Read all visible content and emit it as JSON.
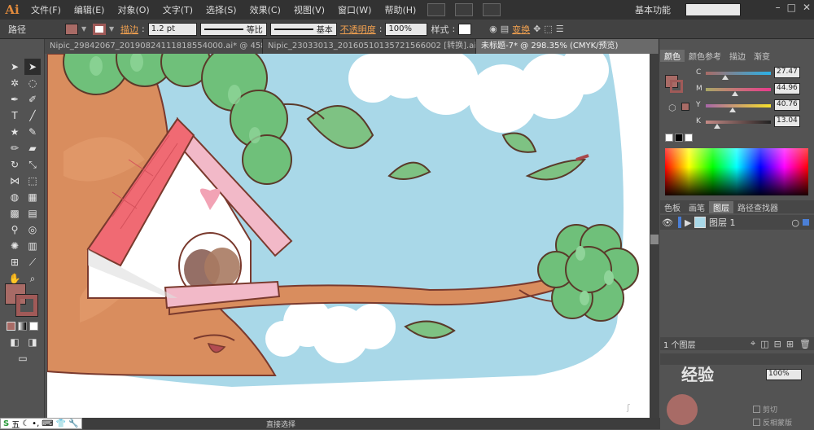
{
  "app": {
    "logo": "Ai"
  },
  "menu": [
    "文件(F)",
    "编辑(E)",
    "对象(O)",
    "文字(T)",
    "选择(S)",
    "效果(C)",
    "视图(V)",
    "窗口(W)",
    "帮助(H)"
  ],
  "workspace": "基本功能",
  "control": {
    "path_label": "路径",
    "stroke_label": "描边",
    "stroke_weight": "1.2 pt",
    "stroke_profile": "等比",
    "brush": "基本",
    "opacity_label": "不透明度",
    "opacity_value": "100%",
    "style_label": "样式",
    "transform_label": "变换"
  },
  "tabs": [
    {
      "label": "Nipic_29842067_20190824111818554000.ai* @ 458...",
      "active": false
    },
    {
      "label": "Nipic_23033013_20160510135721566002 [转换].ai*",
      "active": false
    },
    {
      "label": "未标题-7* @ 298.35% (CMYK/预览)",
      "active": true
    }
  ],
  "color_panel": {
    "tabs": [
      "颜色",
      "颜色参考",
      "描边",
      "渐变"
    ],
    "channels": [
      {
        "name": "C",
        "value": "27.47",
        "fraction": 0.275
      },
      {
        "name": "M",
        "value": "44.96",
        "fraction": 0.45
      },
      {
        "name": "Y",
        "value": "40.76",
        "fraction": 0.408
      },
      {
        "name": "K",
        "value": "13.04",
        "fraction": 0.13
      }
    ]
  },
  "layers_panel": {
    "tabs": [
      "色板",
      "画笔",
      "图层",
      "路径查找器"
    ],
    "layer_name": "图层 1",
    "count_label": "1 个图层"
  },
  "transparency": {
    "opacity": "100%",
    "option1": "剪切",
    "option2": "反相蒙版"
  },
  "status": {
    "tool": "直接选择"
  },
  "ime": {
    "text": "五"
  },
  "watermark": {
    "text": "经验"
  },
  "colors": {
    "fill": "#a86b66",
    "stroke": "#a05a58"
  }
}
